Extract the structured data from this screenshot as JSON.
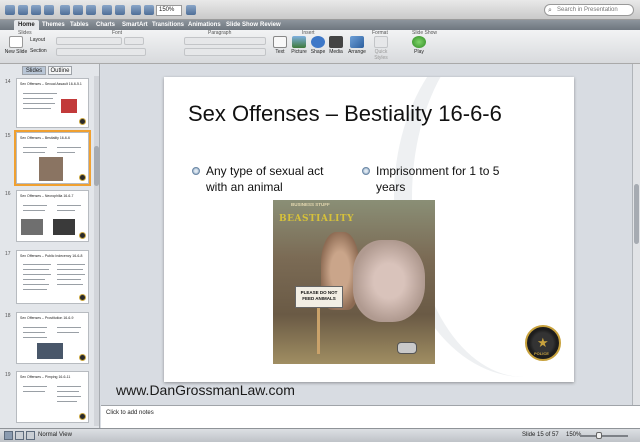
{
  "toolbar": {
    "zoom": "150%",
    "search_placeholder": "Search in Presentation"
  },
  "ribbon_tabs": [
    "Home",
    "Themes",
    "Tables",
    "Charts",
    "SmartArt",
    "Transitions",
    "Animations",
    "Slide Show",
    "Review"
  ],
  "ribbon": {
    "groups": [
      "Slides",
      "Font",
      "Paragraph",
      "Insert",
      "Format",
      "Slide Show"
    ],
    "buttons": {
      "new_slide": "New Slide",
      "layout": "Layout",
      "section": "Section",
      "text": "Text",
      "picture": "Picture",
      "shape": "Shape",
      "media": "Media",
      "arrange": "Arrange",
      "quick_styles": "Quick Styles",
      "play": "Play"
    }
  },
  "sidebar": {
    "tabs": [
      "Slides",
      "Outline"
    ],
    "thumbnails": [
      {
        "number": "14",
        "title": "Sex Offenses – Sexual Assault 16-6-5.1"
      },
      {
        "number": "15",
        "title": "Sex Offenses – Bestiality 16-6-6"
      },
      {
        "number": "16",
        "title": "Sex Offenses – Necrophilia 16-6-7"
      },
      {
        "number": "17",
        "title": "Sex Offenses – Public Indecency 16-6-8"
      },
      {
        "number": "18",
        "title": "Sex Offenses – Prostitution 16-6-9"
      },
      {
        "number": "19",
        "title": "Sex Offenses – Pimping 16-6-11"
      }
    ]
  },
  "slide": {
    "title": "Sex Offenses – Bestiality 16-6-6",
    "bullets": [
      "Any type of sexual act with an animal",
      "Imprisonment for 1 to 5 years"
    ],
    "photo": {
      "top_text": "BUSINESS STUFF",
      "headline": "BEASTIALITY",
      "sign": "PLEASE DO NOT FEED ANIMALS"
    },
    "footer_url": "www.DanGrossmanLaw.com",
    "seal_text": "POLICE"
  },
  "notes": {
    "placeholder": "Click to add notes"
  },
  "status": {
    "view": "Normal View",
    "slide_count": "Slide 15 of 57",
    "zoom": "150%"
  },
  "colors": {
    "accent_selected": "#f0a030",
    "ribbon_dark": "#6e767f"
  }
}
